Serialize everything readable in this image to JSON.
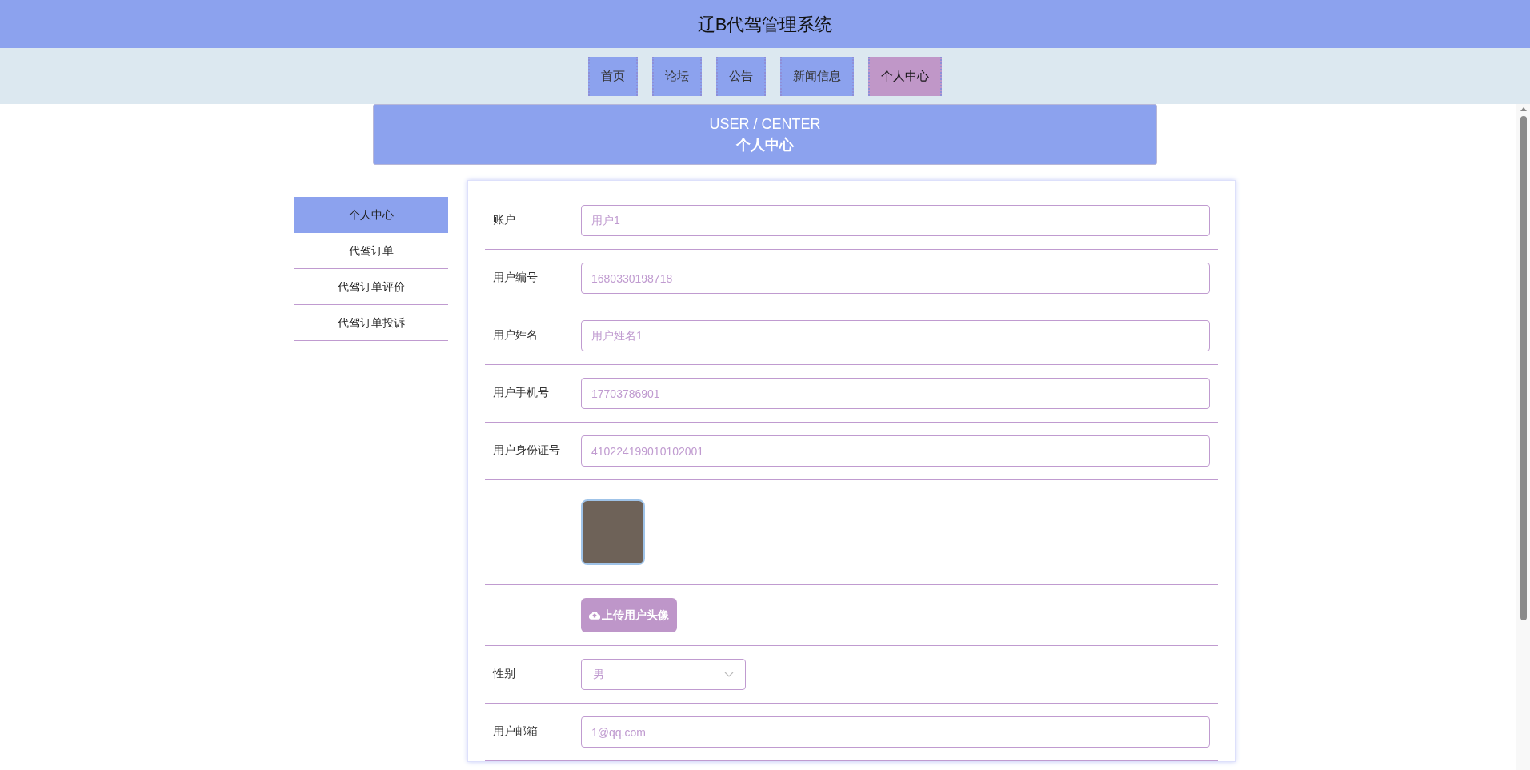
{
  "header": {
    "title": "辽B代驾管理系统"
  },
  "nav": [
    {
      "label": "首页",
      "selected": false
    },
    {
      "label": "论坛",
      "selected": false
    },
    {
      "label": "公告",
      "selected": false
    },
    {
      "label": "新闻信息",
      "selected": false
    },
    {
      "label": "个人中心",
      "selected": true
    }
  ],
  "banner": {
    "title_en": "USER / CENTER",
    "title_cn": "个人中心"
  },
  "sidebar": {
    "items": [
      {
        "label": "个人中心",
        "selected": true
      },
      {
        "label": "代驾订单",
        "selected": false
      },
      {
        "label": "代驾订单评价",
        "selected": false
      },
      {
        "label": "代驾订单投诉",
        "selected": false
      }
    ]
  },
  "form": {
    "fields": [
      {
        "kind": "text",
        "label": "账户",
        "value": "用户1"
      },
      {
        "kind": "text",
        "label": "用户编号",
        "value": "1680330198718"
      },
      {
        "kind": "text",
        "label": "用户姓名",
        "value": "用户姓名1"
      },
      {
        "kind": "text",
        "label": "用户手机号",
        "value": "17703786901"
      },
      {
        "kind": "text",
        "label": "用户身份证号",
        "value": "410224199010102001"
      },
      {
        "kind": "image"
      },
      {
        "kind": "upload",
        "button": "上传用户头像"
      },
      {
        "kind": "select",
        "label": "性别",
        "value": "男"
      },
      {
        "kind": "text",
        "label": "用户邮箱",
        "value": "1@qq.com"
      }
    ]
  }
}
